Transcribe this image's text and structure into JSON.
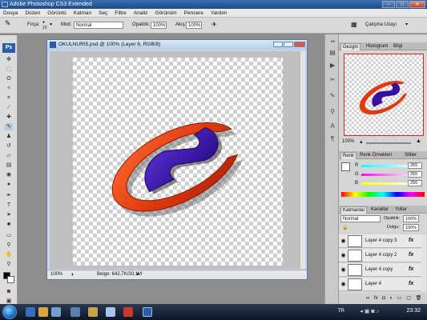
{
  "app": {
    "title": "Adobe Photoshop CS3 Extended",
    "window_buttons": [
      "minimize",
      "maximize",
      "close"
    ]
  },
  "menu": [
    "Dosya",
    "Düzen",
    "Görüntü",
    "Katman",
    "Seç",
    "Filtre",
    "Analiz",
    "Görünüm",
    "Pencere",
    "Yardım"
  ],
  "options": {
    "brush_label": "Fırça:",
    "brush_size": "13",
    "mode_label": "Mod:",
    "mode_value": "Normal",
    "opacity_label": "Opaklık:",
    "opacity_value": "100%",
    "flow_label": "Akış:",
    "flow_value": "100%",
    "workspace_button": "Çalışma Uzayı"
  },
  "tools": [
    "move-icon",
    "marquee-icon",
    "lasso-icon",
    "magic-wand-icon",
    "crop-icon",
    "slice-icon",
    "healing-icon",
    "brush-icon",
    "stamp-icon",
    "history-brush-icon",
    "eraser-icon",
    "gradient-icon",
    "blur-icon",
    "dodge-icon",
    "pen-icon",
    "type-icon",
    "path-select-icon",
    "shape-icon",
    "notes-icon",
    "eyedropper-icon",
    "hand-icon",
    "zoom-icon"
  ],
  "document": {
    "title": "OKULNURI5.psd @ 100% (Layer 6, RGB/8)",
    "zoom": "100%",
    "doc_size": "Belge: 642,7K/30,1M"
  },
  "navigator": {
    "tabs": [
      "Gezgin",
      "Histogram",
      "Bilgi"
    ],
    "zoom": "100%"
  },
  "color_panel": {
    "tabs": [
      "Renk",
      "Renk Örnekleri",
      "Stiller"
    ],
    "channels": [
      {
        "label": "R",
        "value": "255"
      },
      {
        "label": "G",
        "value": "255"
      },
      {
        "label": "B",
        "value": "255"
      }
    ]
  },
  "layers_panel": {
    "tabs": [
      "Katmanlar",
      "Kanallar",
      "Yollar"
    ],
    "blend_mode": "Normal",
    "opacity_label": "Opaklık:",
    "opacity_value": "100%",
    "fill_label": "Dolgu:",
    "fill_value": "100%",
    "layers": [
      {
        "name": "Layer 4 copy 3"
      },
      {
        "name": "Layer 4 copy 2"
      },
      {
        "name": "Layer 4 copy"
      },
      {
        "name": "Layer 4"
      }
    ]
  },
  "taskbar": {
    "language": "TR",
    "clock": "23:32"
  },
  "colors": {
    "logo_red": "#e23a10",
    "logo_purple": "#3a0fa0",
    "title_blue": "#1e4b86"
  }
}
